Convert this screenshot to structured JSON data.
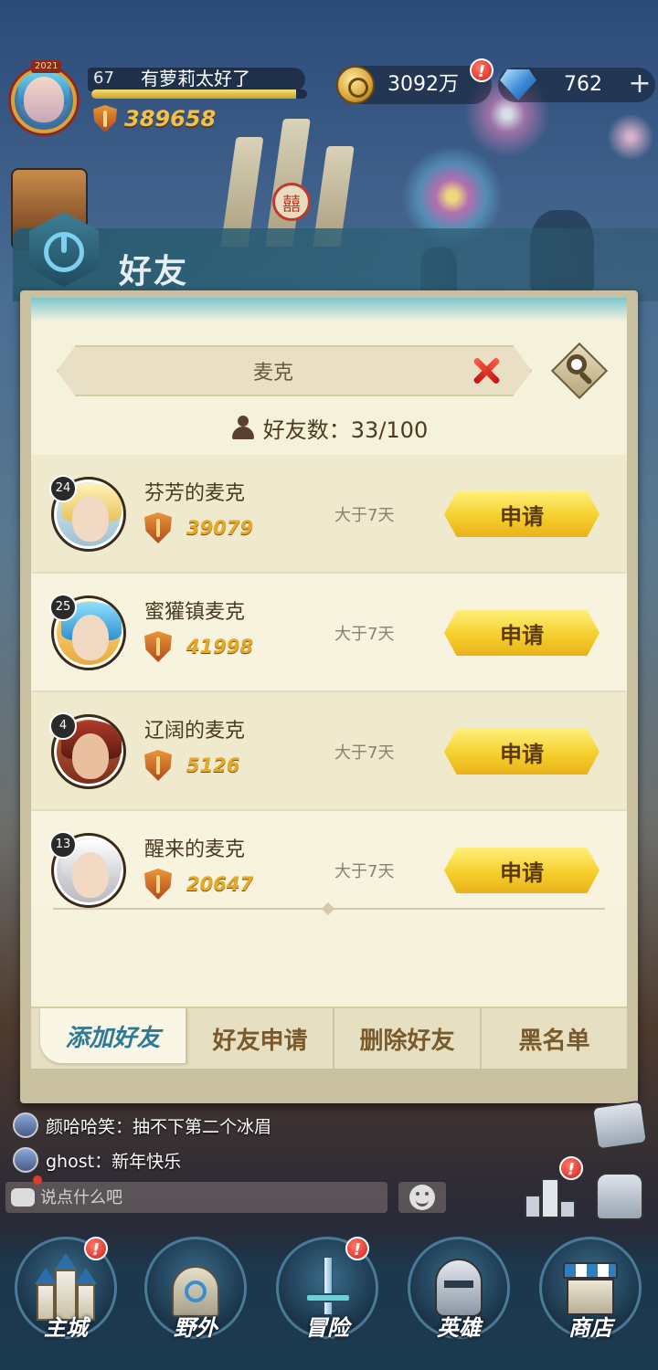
{
  "hud": {
    "avatar_year": "2021",
    "level": "67",
    "player_name": "有萝莉太好了",
    "xp_fraction": 0.95,
    "power": "389658",
    "gold": "3092万",
    "gems": "762"
  },
  "panel": {
    "title": "好友",
    "search_value": "麦克",
    "friend_count_label": "好友数：33/100"
  },
  "results": [
    {
      "level": "24",
      "name": "芬芳的麦克",
      "power": "39079",
      "last_seen": "大于7天",
      "action": "申请"
    },
    {
      "level": "25",
      "name": "蜜獾镇麦克",
      "power": "41998",
      "last_seen": "大于7天",
      "action": "申请"
    },
    {
      "level": "4",
      "name": "辽阔的麦克",
      "power": "5126",
      "last_seen": "大于7天",
      "action": "申请"
    },
    {
      "level": "13",
      "name": "醒来的麦克",
      "power": "20647",
      "last_seen": "大于7天",
      "action": "申请"
    }
  ],
  "tabs": [
    {
      "label": "添加好友",
      "active": true
    },
    {
      "label": "好友申请",
      "active": false
    },
    {
      "label": "删除好友",
      "active": false
    },
    {
      "label": "黑名单",
      "active": false
    }
  ],
  "chat": {
    "lines": [
      {
        "text": "颜哈哈笑：抽不下第二个冰眉"
      },
      {
        "text": "ghost：新年快乐"
      }
    ],
    "input_placeholder": "说点什么吧"
  },
  "badges": {
    "alert": "!"
  },
  "nav": [
    {
      "label": "主城",
      "badge": true
    },
    {
      "label": "野外",
      "badge": false
    },
    {
      "label": "冒险",
      "badge": true
    },
    {
      "label": "英雄",
      "badge": false
    },
    {
      "label": "商店",
      "badge": false
    }
  ],
  "colors": {
    "accent_teal": "#2e7a96",
    "button_yellow": "#f5cf2c",
    "power_gold": "#e5a92a",
    "alert_red": "#d0201a"
  }
}
